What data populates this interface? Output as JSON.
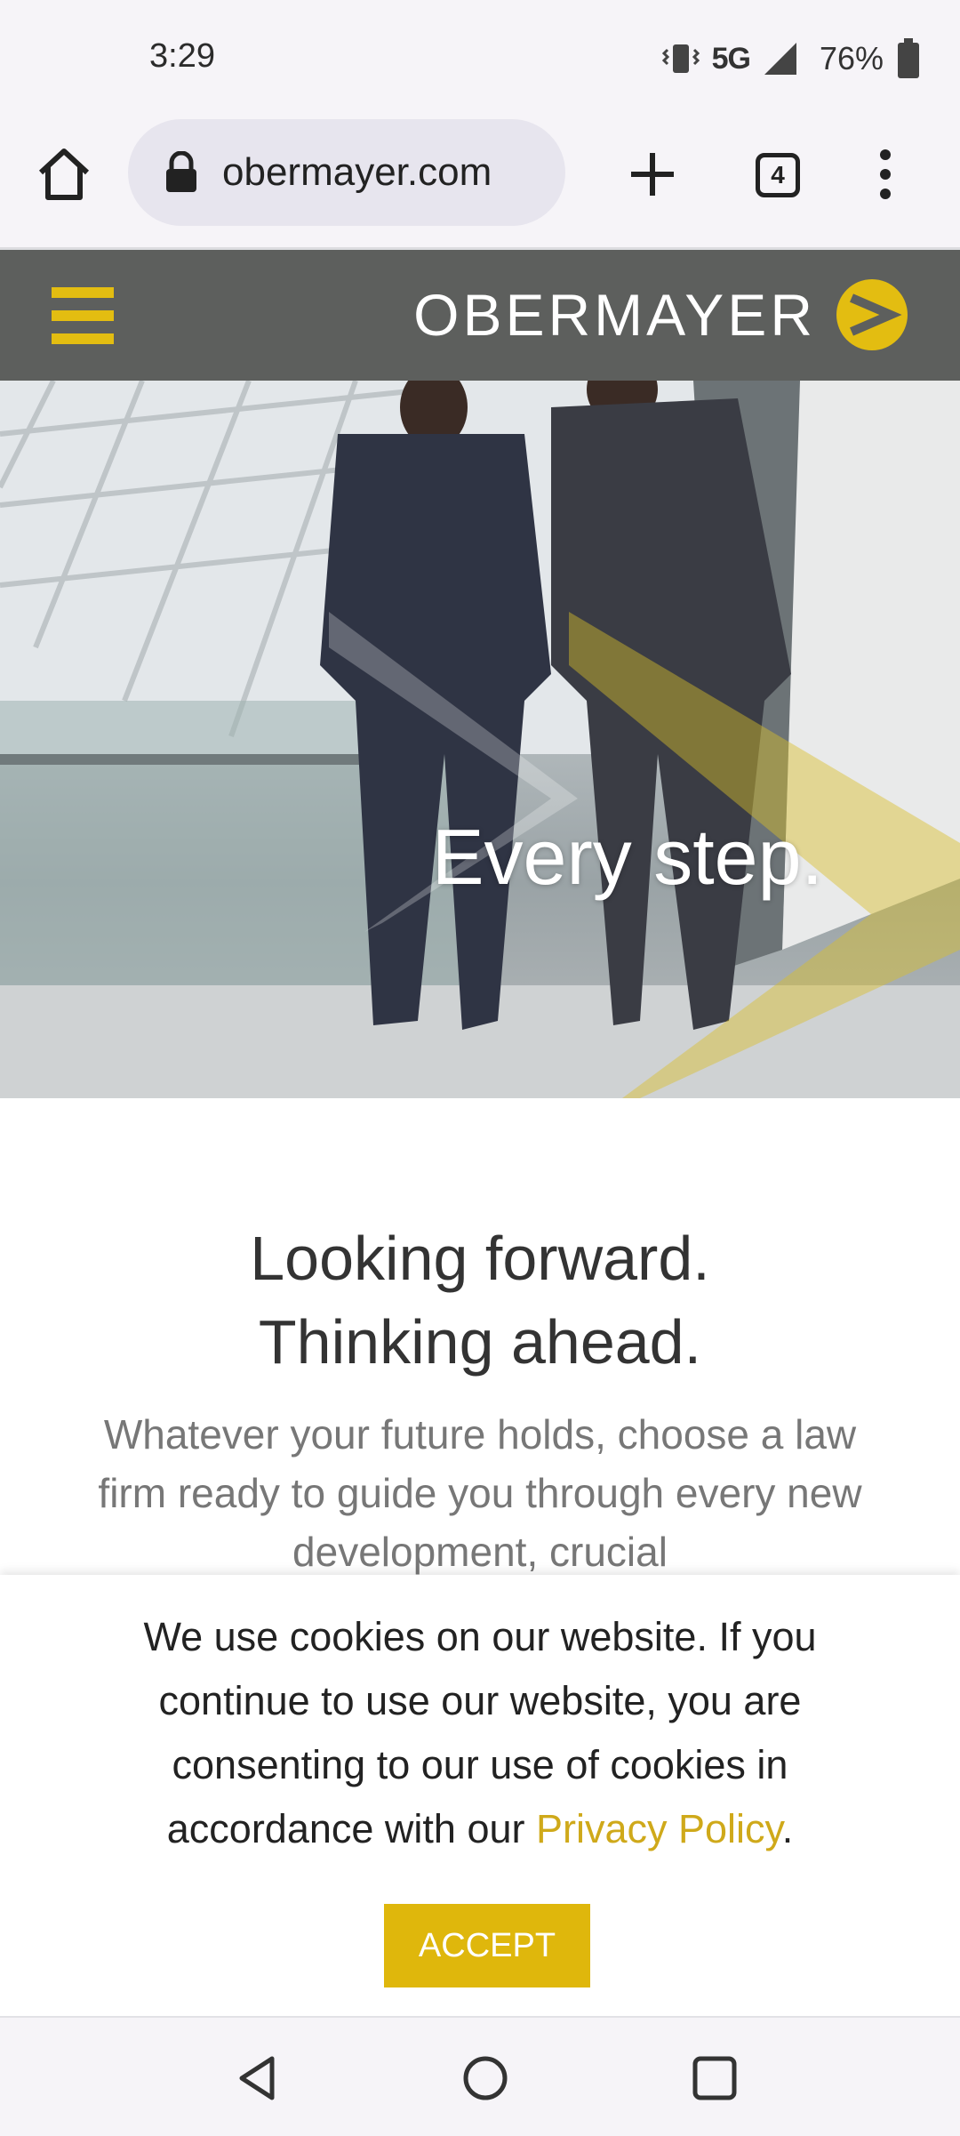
{
  "status_bar": {
    "time": "3:29",
    "network": "5G",
    "battery": "76%",
    "icons": [
      "vibrate-icon",
      "signal-icon",
      "battery-icon"
    ]
  },
  "browser": {
    "url": "obermayer.com",
    "tab_count": "4",
    "icons": [
      "home-icon",
      "lock-icon",
      "plus-icon",
      "tabs-icon",
      "more-vert-icon"
    ]
  },
  "site": {
    "brand": "OBERMAYER",
    "accent_color": "#e3bd11",
    "header_color": "#5d5f5d"
  },
  "hero": {
    "caption": "Every step."
  },
  "content": {
    "headline_line1": "Looking forward.",
    "headline_line2": "Thinking ahead.",
    "lead": "Whatever your future holds, choose a law firm ready to guide you through every new development, crucial"
  },
  "cookie": {
    "text": "We use cookies on our website. If you continue to use our website, you are consenting to our use of cookies in accordance with our ",
    "link_label": "Privacy Policy",
    "suffix": ".",
    "accept_label": "ACCEPT"
  },
  "navbar": {
    "icons": [
      "back-icon",
      "home-circle-icon",
      "recents-icon"
    ]
  }
}
